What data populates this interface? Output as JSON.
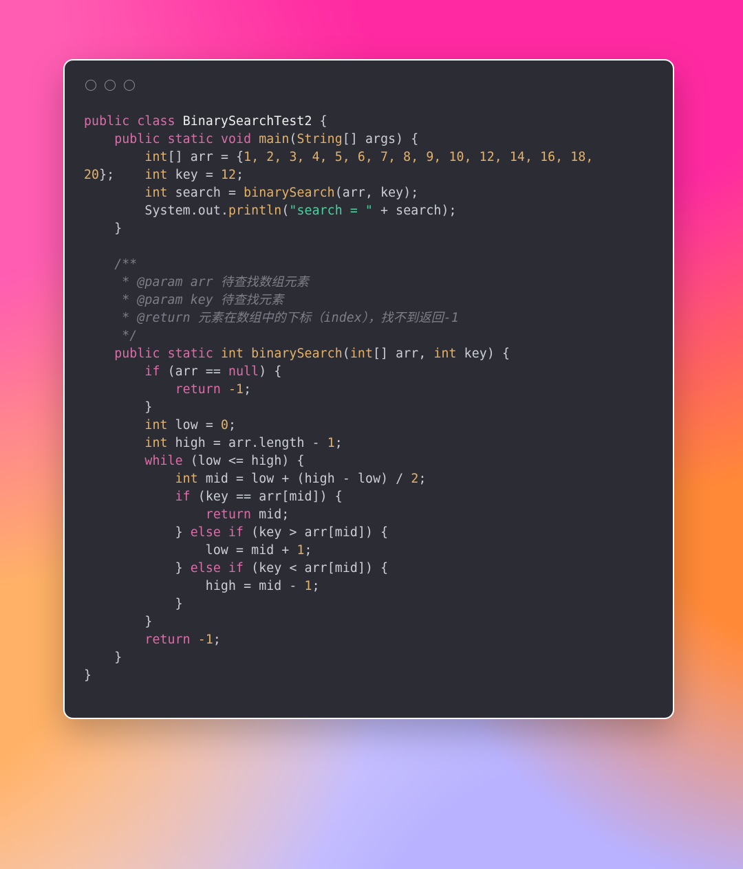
{
  "window": {
    "traffic_light_count": 3
  },
  "code": {
    "language": "java",
    "class_name": "BinarySearchTest2",
    "main": {
      "arr_values": [
        1,
        2,
        3,
        4,
        5,
        6,
        7,
        8,
        9,
        10,
        12,
        14,
        16,
        18,
        20
      ],
      "key_value": 12,
      "search_var": "search",
      "println_string": "\"search = \""
    },
    "javadoc": {
      "open": "/**",
      "lines": [
        " * @param arr 待查找数组元素",
        " * @param key 待查找元素",
        " * @return 元素在数组中的下标（index），找不到返回-1"
      ],
      "close": " */"
    },
    "binarySearch": {
      "name": "binarySearch",
      "return_type": "int",
      "params": "int[] arr, int key",
      "low_init": 0,
      "high_expr": "arr.length - 1",
      "mid_expr": "low + (high - low) / 2",
      "not_found_return": -1
    },
    "tokens": {
      "public": "public",
      "class": "class",
      "static": "static",
      "void": "void",
      "int": "int",
      "String": "String",
      "return": "return",
      "while": "while",
      "if": "if",
      "else": "else",
      "null": "null",
      "main": "main",
      "args": "args",
      "arr": "arr",
      "key": "key",
      "low": "low",
      "high": "high",
      "mid": "mid",
      "length": "length",
      "System": "System",
      "out": "out",
      "println": "println",
      "eq": "=",
      "eqeq": "==",
      "lte": "<=",
      "gt": ">",
      "lt": "<",
      "plus": "+",
      "minus": "-",
      "div": "/",
      "neg1": "-1",
      "one": "1",
      "two": "2",
      "zero": "0",
      "semi": ";",
      "comma": ",",
      "lbrace": "{",
      "rbrace": "}",
      "lparen": "(",
      "rparen": ")",
      "lbrack": "[",
      "rbrack": "]",
      "lrbrack": "[]"
    },
    "arr_literal_str": "1, 2, 3, 4, 5, 6, 7, 8, 9, 10, 12, 14, 16, 18, 20"
  }
}
